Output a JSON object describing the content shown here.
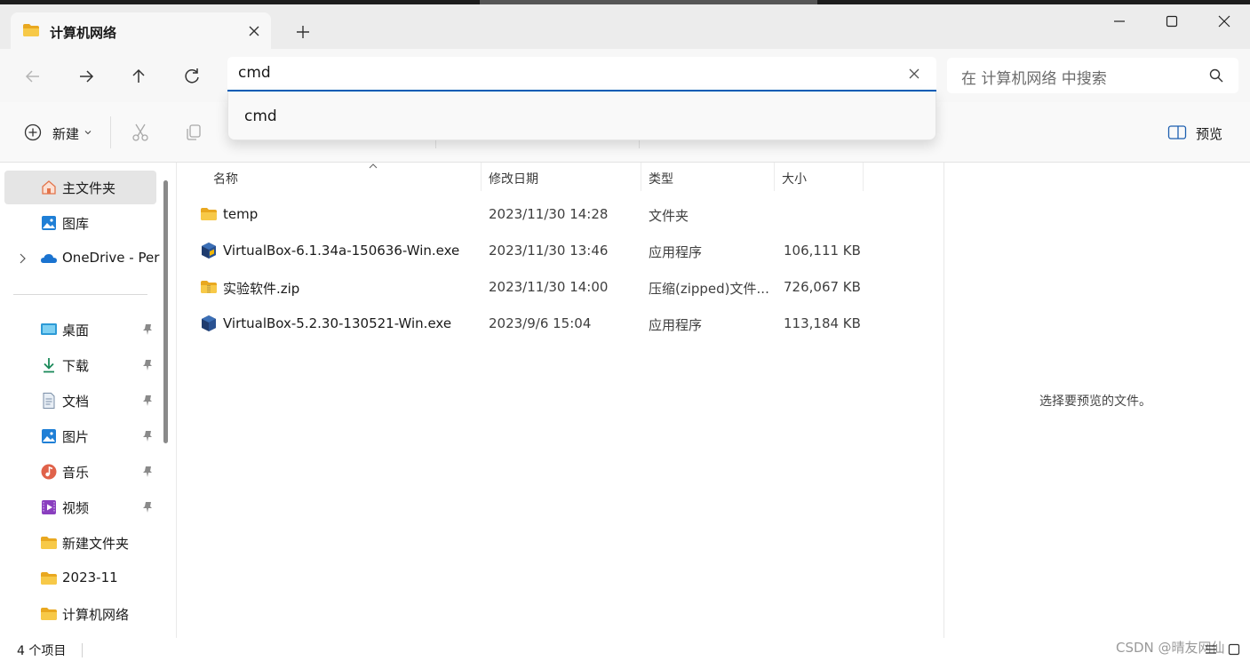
{
  "window": {
    "tab_title": "计算机网络"
  },
  "address": {
    "value": "cmd",
    "suggestions": [
      "cmd"
    ]
  },
  "search": {
    "placeholder": "在 计算机网络 中搜索"
  },
  "toolbar": {
    "new_label": "新建",
    "preview_label": "预览"
  },
  "sidebar": {
    "items": [
      {
        "label": "主文件夹",
        "icon": "home-icon",
        "selected": true,
        "pinned": false
      },
      {
        "label": "图库",
        "icon": "gallery-icon",
        "pinned": false
      },
      {
        "label": "OneDrive - Per",
        "icon": "onedrive-cloud-icon",
        "expandable": true,
        "pinned": false
      },
      {
        "label": "桌面",
        "icon": "desktop-icon",
        "pinned": true
      },
      {
        "label": "下载",
        "icon": "download-icon",
        "pinned": true
      },
      {
        "label": "文档",
        "icon": "document-icon",
        "pinned": true
      },
      {
        "label": "图片",
        "icon": "pictures-icon",
        "pinned": true
      },
      {
        "label": "音乐",
        "icon": "music-icon",
        "pinned": true
      },
      {
        "label": "视频",
        "icon": "video-icon",
        "pinned": true
      },
      {
        "label": "新建文件夹",
        "icon": "folder-icon",
        "pinned": false
      },
      {
        "label": "2023-11",
        "icon": "folder-icon",
        "pinned": false
      },
      {
        "label": "计算机网络",
        "icon": "folder-icon",
        "pinned": false
      }
    ]
  },
  "files": {
    "columns": [
      "名称",
      "修改日期",
      "类型",
      "大小"
    ],
    "rows": [
      {
        "name": "temp",
        "modified": "2023/11/30 14:28",
        "type": "文件夹",
        "size": "",
        "icon": "folder-icon"
      },
      {
        "name": "VirtualBox-6.1.34a-150636-Win.exe",
        "modified": "2023/11/30 13:46",
        "type": "应用程序",
        "size": "106,111 KB",
        "icon": "virtualbox-app-icon"
      },
      {
        "name": "实验软件.zip",
        "modified": "2023/11/30 14:00",
        "type": "压缩(zipped)文件...",
        "size": "726,067 KB",
        "icon": "zip-folder-icon"
      },
      {
        "name": "VirtualBox-5.2.30-130521-Win.exe",
        "modified": "2023/9/6 15:04",
        "type": "应用程序",
        "size": "113,184 KB",
        "icon": "virtualbox-app-icon"
      }
    ]
  },
  "preview_pane": {
    "message": "选择要预览的文件。"
  },
  "status": {
    "item_count": "4 个项目",
    "watermark": "CSDN @晴友网仙"
  },
  "colors": {
    "accent": "#005fb8",
    "folder": "#f7c948",
    "titlebar": "#ececec"
  }
}
